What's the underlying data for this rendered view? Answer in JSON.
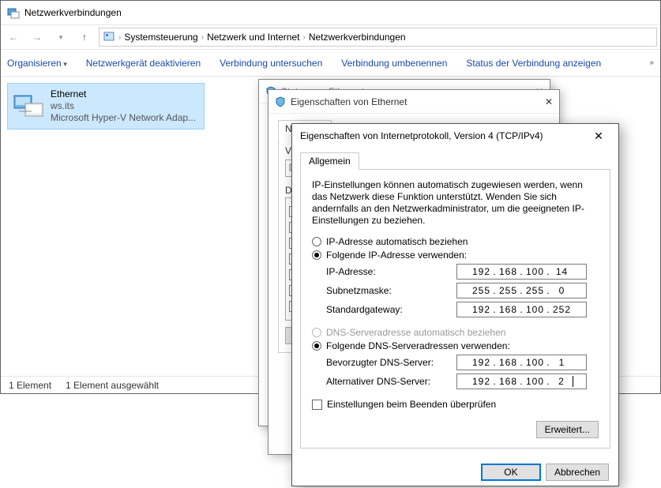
{
  "window": {
    "title": "Netzwerkverbindungen",
    "breadcrumb": [
      "Systemsteuerung",
      "Netzwerk und Internet",
      "Netzwerkverbindungen"
    ]
  },
  "cmdbar": {
    "organize": "Organisieren",
    "deactivate": "Netzwerkgerät deaktivieren",
    "diagnose": "Verbindung untersuchen",
    "rename": "Verbindung umbenennen",
    "status": "Status der Verbindung anzeigen"
  },
  "adapter": {
    "name": "Ethernet",
    "domain": "ws.its",
    "driver": "Microsoft Hyper-V Network Adap..."
  },
  "statusbar": {
    "count": "1 Element",
    "selected": "1 Element ausgewählt"
  },
  "hint1": {
    "title": "Status von Ethernet"
  },
  "hint2": {
    "title": "Eigenschaften von Ethernet",
    "tab": "Netzwerk",
    "connect_label_prefix": "Ve",
    "items_label_prefix": "Die"
  },
  "ipv4": {
    "title": "Eigenschaften von Internetprotokoll, Version 4 (TCP/IPv4)",
    "tab": "Allgemein",
    "intro": "IP-Einstellungen können automatisch zugewiesen werden, wenn das Netzwerk diese Funktion unterstützt. Wenden Sie sich andernfalls an den Netzwerkadministrator, um die geeigneten IP-Einstellungen zu beziehen.",
    "ip_auto": "IP-Adresse automatisch beziehen",
    "ip_manual": "Folgende IP-Adresse verwenden:",
    "ip_label": "IP-Adresse:",
    "mask_label": "Subnetzmaske:",
    "gw_label": "Standardgateway:",
    "dns_auto": "DNS-Serveradresse automatisch beziehen",
    "dns_manual": "Folgende DNS-Serveradressen verwenden:",
    "dns1_label": "Bevorzugter DNS-Server:",
    "dns2_label": "Alternativer DNS-Server:",
    "validate": "Einstellungen beim Beenden überprüfen",
    "advanced": "Erweitert...",
    "ok": "OK",
    "cancel": "Abbrechen",
    "ip": [
      "192",
      "168",
      "100",
      "14"
    ],
    "mask": [
      "255",
      "255",
      "255",
      "0"
    ],
    "gw": [
      "192",
      "168",
      "100",
      "252"
    ],
    "dns1": [
      "192",
      "168",
      "100",
      "1"
    ],
    "dns2": [
      "192",
      "168",
      "100",
      "2"
    ]
  }
}
